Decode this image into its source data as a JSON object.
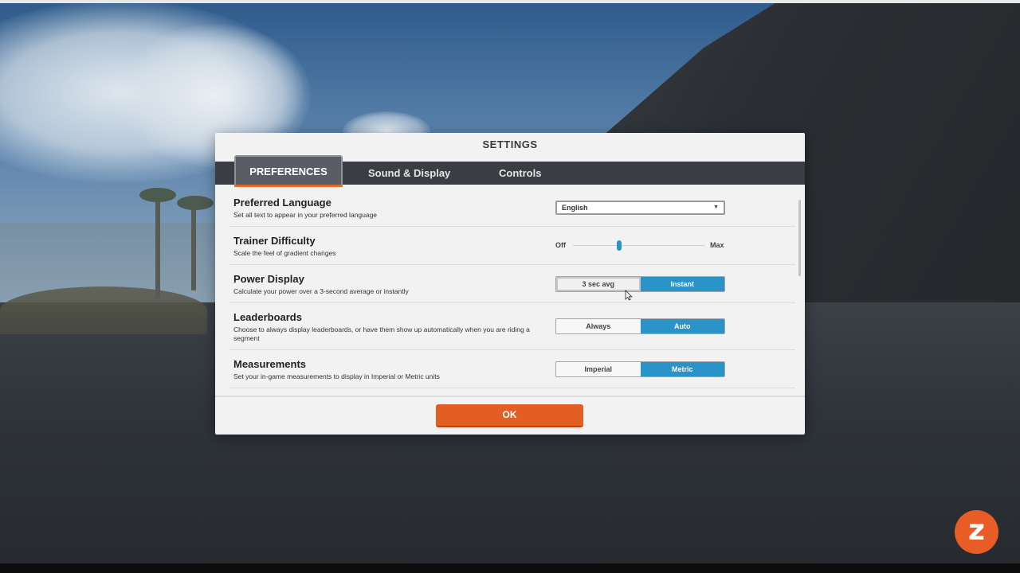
{
  "dialog": {
    "title": "SETTINGS",
    "tabs": [
      {
        "label": "PREFERENCES",
        "active": true
      },
      {
        "label": "Sound & Display",
        "active": false
      },
      {
        "label": "Controls",
        "active": false
      }
    ],
    "ok_label": "OK"
  },
  "settings": {
    "language": {
      "title": "Preferred Language",
      "description": "Set all text to appear in your preferred language",
      "value": "English"
    },
    "difficulty": {
      "title": "Trainer Difficulty",
      "description": "Scale the feel of gradient changes",
      "min_label": "Off",
      "max_label": "Max",
      "level_fraction": 0.35
    },
    "power": {
      "title": "Power Display",
      "description": "Calculate your power over a 3-second average or instantly",
      "options": [
        "3 sec avg",
        "Instant"
      ],
      "selected": "Instant"
    },
    "leaderboards": {
      "title": "Leaderboards",
      "description": "Choose to always display leaderboards, or have them show up automatically when you are riding a segment",
      "options": [
        "Always",
        "Auto"
      ],
      "selected": "Auto"
    },
    "measurements": {
      "title": "Measurements",
      "description": "Set your in-game measurements to display in Imperial or Metric units",
      "options": [
        "Imperial",
        "Metric"
      ],
      "selected": "Metric"
    }
  },
  "colors": {
    "accent_orange": "#e25e22",
    "toggle_blue": "#2a93c8",
    "tabbar": "#3a3d42"
  },
  "icons": {
    "dropdown": "chevron-down-icon",
    "app_logo": "zwift-logo-icon",
    "pointer": "mouse-cursor-icon"
  },
  "logo": {
    "glyph": "z"
  }
}
